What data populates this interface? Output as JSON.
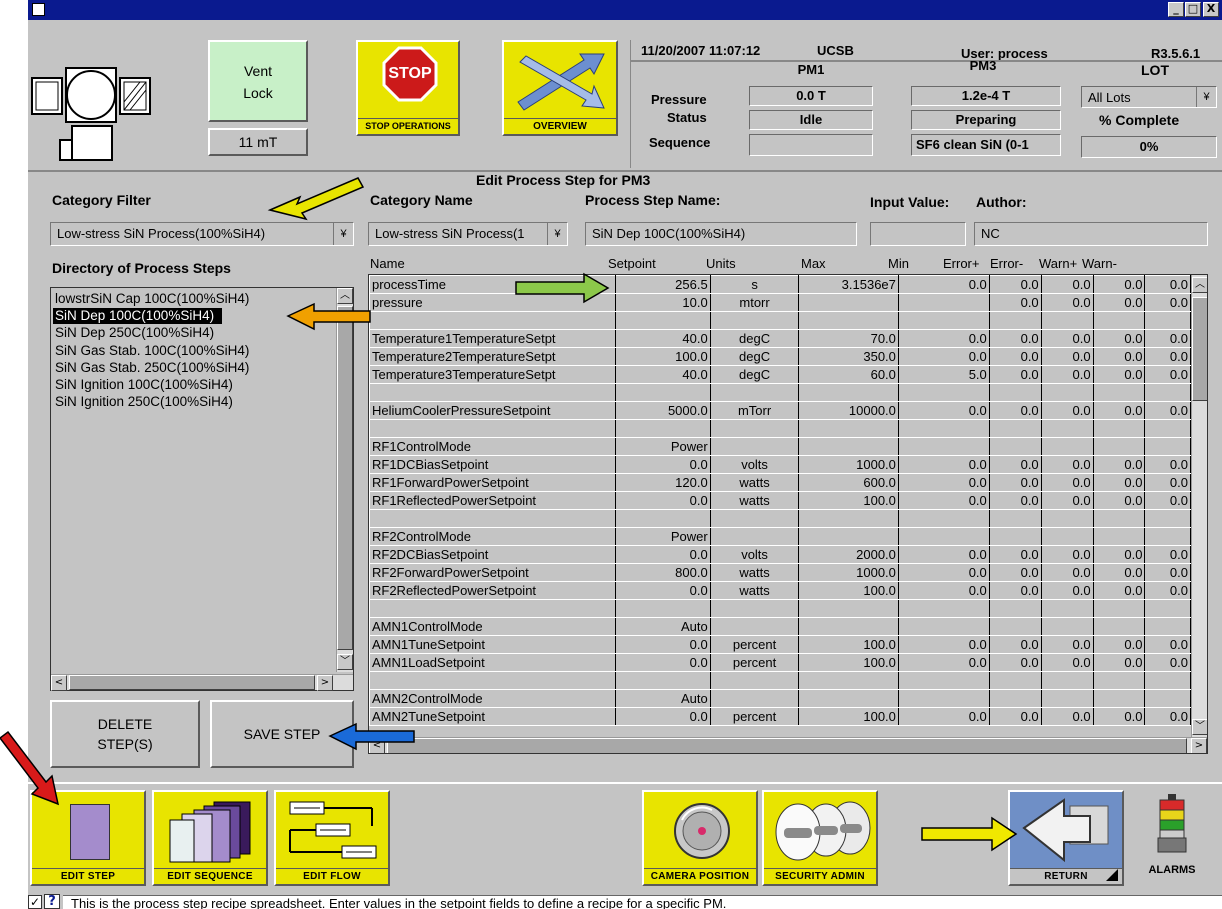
{
  "window": {
    "min": "_",
    "max": "□",
    "close": "X"
  },
  "header": {
    "vent_lock_label": "Vent Lock",
    "pressure_readout": "11 mT",
    "stop_label": "STOP OPERATIONS",
    "stop_sign": "STOP",
    "overview_label": "OVERVIEW",
    "datetime": "11/20/2007  11:07:12",
    "site": "UCSB",
    "user": "User: process",
    "version": "R3.5.6.1",
    "pm1": "PM1",
    "pm3": "PM3",
    "lot": "LOT",
    "pressure_label": "Pressure",
    "status_label": "Status",
    "sequence_label": "Sequence",
    "pm1_pressure": "0.0 T",
    "pm1_status": "Idle",
    "pm1_sequence": "",
    "pm3_pressure": "1.2e-4  T",
    "pm3_status": "Preparing",
    "pm3_sequence": "SF6 clean SiN (0-1",
    "lot_select": "All Lots",
    "complete_label": "% Complete",
    "complete_value": "0%"
  },
  "editor": {
    "title": "Edit Process Step for PM3",
    "category_filter_label": "Category Filter",
    "category_filter_value": "Low-stress SiN Process(100%SiH4)",
    "category_name_label": "Category Name",
    "category_name_value": "Low-stress SiN Process(1",
    "step_name_label": "Process Step Name:",
    "step_name_value": "SiN Dep 100C(100%SiH4)",
    "input_value_label": "Input Value:",
    "input_value": "",
    "author_label": "Author:",
    "author_value": "NC",
    "directory_label": "Directory of Process Steps",
    "dropdown_glyph": "¥"
  },
  "directory": [
    "lowstrSiN Cap 100C(100%SiH4)",
    "SiN Dep 100C(100%SiH4)",
    "SiN Dep 250C(100%SiH4)",
    "SiN Gas Stab. 100C(100%SiH4)",
    "SiN Gas Stab. 250C(100%SiH4)",
    "SiN Ignition 100C(100%SiH4)",
    "SiN Ignition 250C(100%SiH4)"
  ],
  "columns": {
    "name": "Name",
    "setpoint": "Setpoint",
    "units": "Units",
    "max": "Max",
    "min": "Min",
    "errp": "Error+",
    "errm": "Error-",
    "warnp": "Warn+",
    "warnm": "Warn-"
  },
  "rows": [
    {
      "name": "processTime",
      "setpoint": "256.5",
      "units": "s",
      "max": "3.1536e7",
      "min": "0.0",
      "errp": "0.0",
      "errm": "0.0",
      "warnp": "0.0",
      "warnm": "0.0"
    },
    {
      "name": "pressure",
      "setpoint": "10.0",
      "units": "mtorr",
      "max": "",
      "min": "",
      "errp": "0.0",
      "errm": "0.0",
      "warnp": "0.0",
      "warnm": "0.0"
    },
    {
      "name": "",
      "setpoint": "",
      "units": "",
      "max": "",
      "min": "",
      "errp": "",
      "errm": "",
      "warnp": "",
      "warnm": ""
    },
    {
      "name": "Temperature1TemperatureSetpt",
      "setpoint": "40.0",
      "units": "degC",
      "max": "70.0",
      "min": "0.0",
      "errp": "0.0",
      "errm": "0.0",
      "warnp": "0.0",
      "warnm": "0.0"
    },
    {
      "name": "Temperature2TemperatureSetpt",
      "setpoint": "100.0",
      "units": "degC",
      "max": "350.0",
      "min": "0.0",
      "errp": "0.0",
      "errm": "0.0",
      "warnp": "0.0",
      "warnm": "0.0"
    },
    {
      "name": "Temperature3TemperatureSetpt",
      "setpoint": "40.0",
      "units": "degC",
      "max": "60.0",
      "min": "5.0",
      "errp": "0.0",
      "errm": "0.0",
      "warnp": "0.0",
      "warnm": "0.0"
    },
    {
      "name": "",
      "setpoint": "",
      "units": "",
      "max": "",
      "min": "",
      "errp": "",
      "errm": "",
      "warnp": "",
      "warnm": ""
    },
    {
      "name": "HeliumCoolerPressureSetpoint",
      "setpoint": "5000.0",
      "units": "mTorr",
      "max": "10000.0",
      "min": "0.0",
      "errp": "0.0",
      "errm": "0.0",
      "warnp": "0.0",
      "warnm": "0.0"
    },
    {
      "name": "",
      "setpoint": "",
      "units": "",
      "max": "",
      "min": "",
      "errp": "",
      "errm": "",
      "warnp": "",
      "warnm": ""
    },
    {
      "name": "RF1ControlMode",
      "setpoint": "Power",
      "units": "",
      "max": "",
      "min": "",
      "errp": "",
      "errm": "",
      "warnp": "",
      "warnm": ""
    },
    {
      "name": "RF1DCBiasSetpoint",
      "setpoint": "0.0",
      "units": "volts",
      "max": "1000.0",
      "min": "0.0",
      "errp": "0.0",
      "errm": "0.0",
      "warnp": "0.0",
      "warnm": "0.0"
    },
    {
      "name": "RF1ForwardPowerSetpoint",
      "setpoint": "120.0",
      "units": "watts",
      "max": "600.0",
      "min": "0.0",
      "errp": "0.0",
      "errm": "0.0",
      "warnp": "0.0",
      "warnm": "0.0"
    },
    {
      "name": "RF1ReflectedPowerSetpoint",
      "setpoint": "0.0",
      "units": "watts",
      "max": "100.0",
      "min": "0.0",
      "errp": "0.0",
      "errm": "0.0",
      "warnp": "0.0",
      "warnm": "0.0"
    },
    {
      "name": "",
      "setpoint": "",
      "units": "",
      "max": "",
      "min": "",
      "errp": "",
      "errm": "",
      "warnp": "",
      "warnm": ""
    },
    {
      "name": "RF2ControlMode",
      "setpoint": "Power",
      "units": "",
      "max": "",
      "min": "",
      "errp": "",
      "errm": "",
      "warnp": "",
      "warnm": ""
    },
    {
      "name": "RF2DCBiasSetpoint",
      "setpoint": "0.0",
      "units": "volts",
      "max": "2000.0",
      "min": "0.0",
      "errp": "0.0",
      "errm": "0.0",
      "warnp": "0.0",
      "warnm": "0.0"
    },
    {
      "name": "RF2ForwardPowerSetpoint",
      "setpoint": "800.0",
      "units": "watts",
      "max": "1000.0",
      "min": "0.0",
      "errp": "0.0",
      "errm": "0.0",
      "warnp": "0.0",
      "warnm": "0.0"
    },
    {
      "name": "RF2ReflectedPowerSetpoint",
      "setpoint": "0.0",
      "units": "watts",
      "max": "100.0",
      "min": "0.0",
      "errp": "0.0",
      "errm": "0.0",
      "warnp": "0.0",
      "warnm": "0.0"
    },
    {
      "name": "",
      "setpoint": "",
      "units": "",
      "max": "",
      "min": "",
      "errp": "",
      "errm": "",
      "warnp": "",
      "warnm": ""
    },
    {
      "name": "AMN1ControlMode",
      "setpoint": "Auto",
      "units": "",
      "max": "",
      "min": "",
      "errp": "",
      "errm": "",
      "warnp": "",
      "warnm": ""
    },
    {
      "name": "AMN1TuneSetpoint",
      "setpoint": "0.0",
      "units": "percent",
      "max": "100.0",
      "min": "0.0",
      "errp": "0.0",
      "errm": "0.0",
      "warnp": "0.0",
      "warnm": "0.0"
    },
    {
      "name": "AMN1LoadSetpoint",
      "setpoint": "0.0",
      "units": "percent",
      "max": "100.0",
      "min": "0.0",
      "errp": "0.0",
      "errm": "0.0",
      "warnp": "0.0",
      "warnm": "0.0"
    },
    {
      "name": "",
      "setpoint": "",
      "units": "",
      "max": "",
      "min": "",
      "errp": "",
      "errm": "",
      "warnp": "",
      "warnm": ""
    },
    {
      "name": "AMN2ControlMode",
      "setpoint": "Auto",
      "units": "",
      "max": "",
      "min": "",
      "errp": "",
      "errm": "",
      "warnp": "",
      "warnm": ""
    },
    {
      "name": "AMN2TuneSetpoint",
      "setpoint": "0.0",
      "units": "percent",
      "max": "100.0",
      "min": "0.0",
      "errp": "0.0",
      "errm": "0.0",
      "warnp": "0.0",
      "warnm": "0.0"
    }
  ],
  "actions": {
    "delete": "DELETE STEP(S)",
    "save": "SAVE STEP"
  },
  "toolbar": {
    "edit_step": "EDIT STEP",
    "edit_sequence": "EDIT SEQUENCE",
    "edit_flow": "EDIT FLOW",
    "camera_position": "CAMERA POSITION",
    "security_admin": "SECURITY ADMIN",
    "return": "RETURN",
    "alarms": "ALARMS"
  },
  "status": {
    "check": "✓",
    "help": "?",
    "message": "This is the process step recipe spreadsheet.  Enter values in the setpoint fields to define a recipe for a specific PM."
  },
  "colors": {
    "accent_yellow": "#e8e400",
    "titlebar": "#0a1a8f",
    "panel": "#c4c4c4",
    "return_blue": "#6f8fc6"
  }
}
